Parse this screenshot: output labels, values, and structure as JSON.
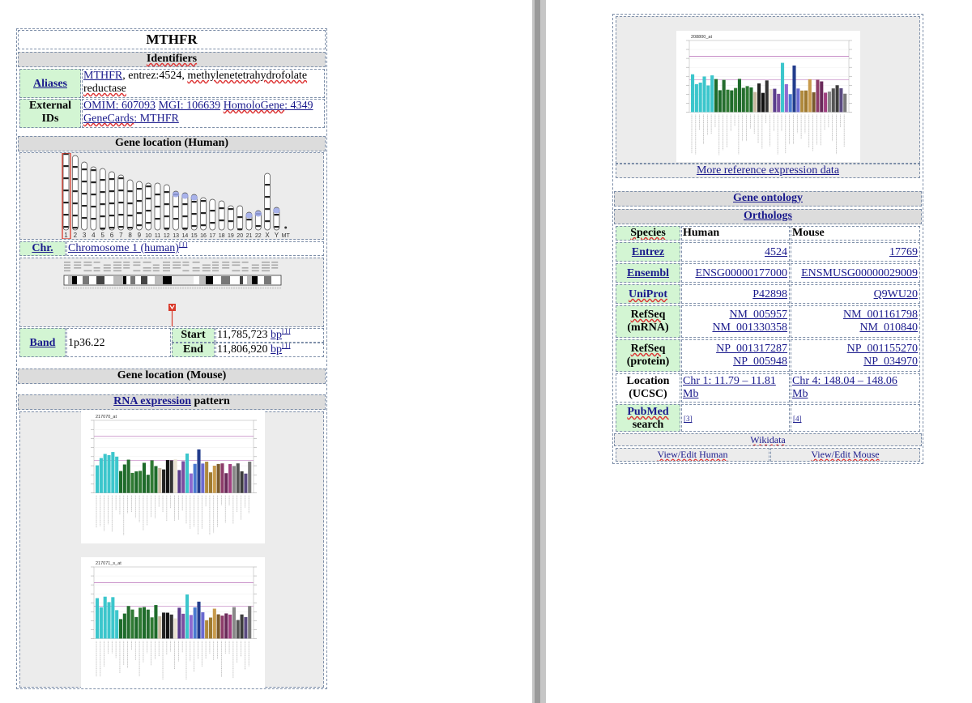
{
  "infobox": {
    "title": "MTHFR",
    "identifiers_header": "Identifiers",
    "aliases_label": "Aliases",
    "aliases_link": "MTHFR",
    "aliases_rest": ", entrez:4524, ",
    "aliases_desc_1": "methylenetetrahydrofolate",
    "aliases_desc_2": "reductase",
    "external_label_1": "External",
    "external_label_2": "IDs",
    "omim": "OMIM: 607093",
    "mgi": "MGI: 106639",
    "homologene_label": "HomoloGene",
    "homologene_value": ": 4349",
    "genecards_label": "GeneCards",
    "genecards_value": ": MTHFR",
    "gene_location_human": "Gene location (Human)",
    "chromosome_labels": [
      "1",
      "2",
      "3",
      "4",
      "5",
      "6",
      "7",
      "8",
      "9",
      "10",
      "11",
      "12",
      "13",
      "14",
      "15",
      "16",
      "17",
      "18",
      "19",
      "20",
      "21",
      "22",
      "X",
      "Y",
      "MT"
    ],
    "chr_label": "Chr.",
    "chr_value": "Chromosome 1 (human)",
    "chr_ref": "[1]",
    "band_label": "Band",
    "band_value": "1p36.22",
    "start_label": "Start",
    "start_value": "11,785,723",
    "end_label": "End",
    "end_value": "11,806,920",
    "bp_unit": "bp",
    "bp_ref": "[1]",
    "gene_location_mouse": "Gene location (Mouse)",
    "rna_expression_link": "RNA expression",
    "rna_expression_rest": " pattern",
    "probe_1": "217070_at",
    "probe_2": "217071_s_at",
    "probe_3": "208800_at",
    "more_expression": "More reference expression data",
    "gene_ontology": "Gene ontology",
    "orthologs": "Orthologs",
    "species_label": "Species",
    "human_label": "Human",
    "mouse_label": "Mouse",
    "entrez_label": "Entrez",
    "entrez_human": "4524",
    "entrez_mouse": "17769",
    "ensembl_label": "Ensembl",
    "ensembl_human": "ENSG00000177000",
    "ensembl_mouse": "ENSMUSG00000029009",
    "uniprot_label": "UniProt",
    "uniprot_human": "P42898",
    "uniprot_mouse": "Q9WU20",
    "refseq_mrna_label_1": "RefSeq",
    "refseq_mrna_label_2": "(mRNA)",
    "refseq_mrna_human_1": "NM_005957",
    "refseq_mrna_human_2": "NM_001330358",
    "refseq_mrna_mouse_1": "NM_001161798",
    "refseq_mrna_mouse_2": "NM_010840",
    "refseq_protein_label_1": "RefSeq",
    "refseq_protein_label_2": "(protein)",
    "refseq_protein_human_1": "NP_001317287",
    "refseq_protein_human_2": "NP_005948",
    "refseq_protein_mouse_1": "NP_001155270",
    "refseq_protein_mouse_2": "NP_034970",
    "location_label_1": "Location",
    "location_label_2": "(UCSC)",
    "location_human_1": "Chr 1: 11.79 – 11.81",
    "location_human_2": "Mb",
    "location_mouse_1": "Chr 4: 148.04 – 148.06",
    "location_mouse_2": "Mb",
    "pubmed_label_1": "PubMed",
    "pubmed_label_2": "search",
    "pubmed_human": "[3]",
    "pubmed_mouse": "[4]",
    "wikidata": "Wikidata",
    "view_edit_human": "View/Edit Human",
    "view_edit_mouse": "View/Edit Mouse"
  },
  "colors": {
    "header_gray": "#dcdcdc",
    "key_green": "#d3f5d3",
    "link_blue": "#1a1a8c",
    "border_dash": "#7d8ea8",
    "marker_red": "#d93a2b"
  }
}
